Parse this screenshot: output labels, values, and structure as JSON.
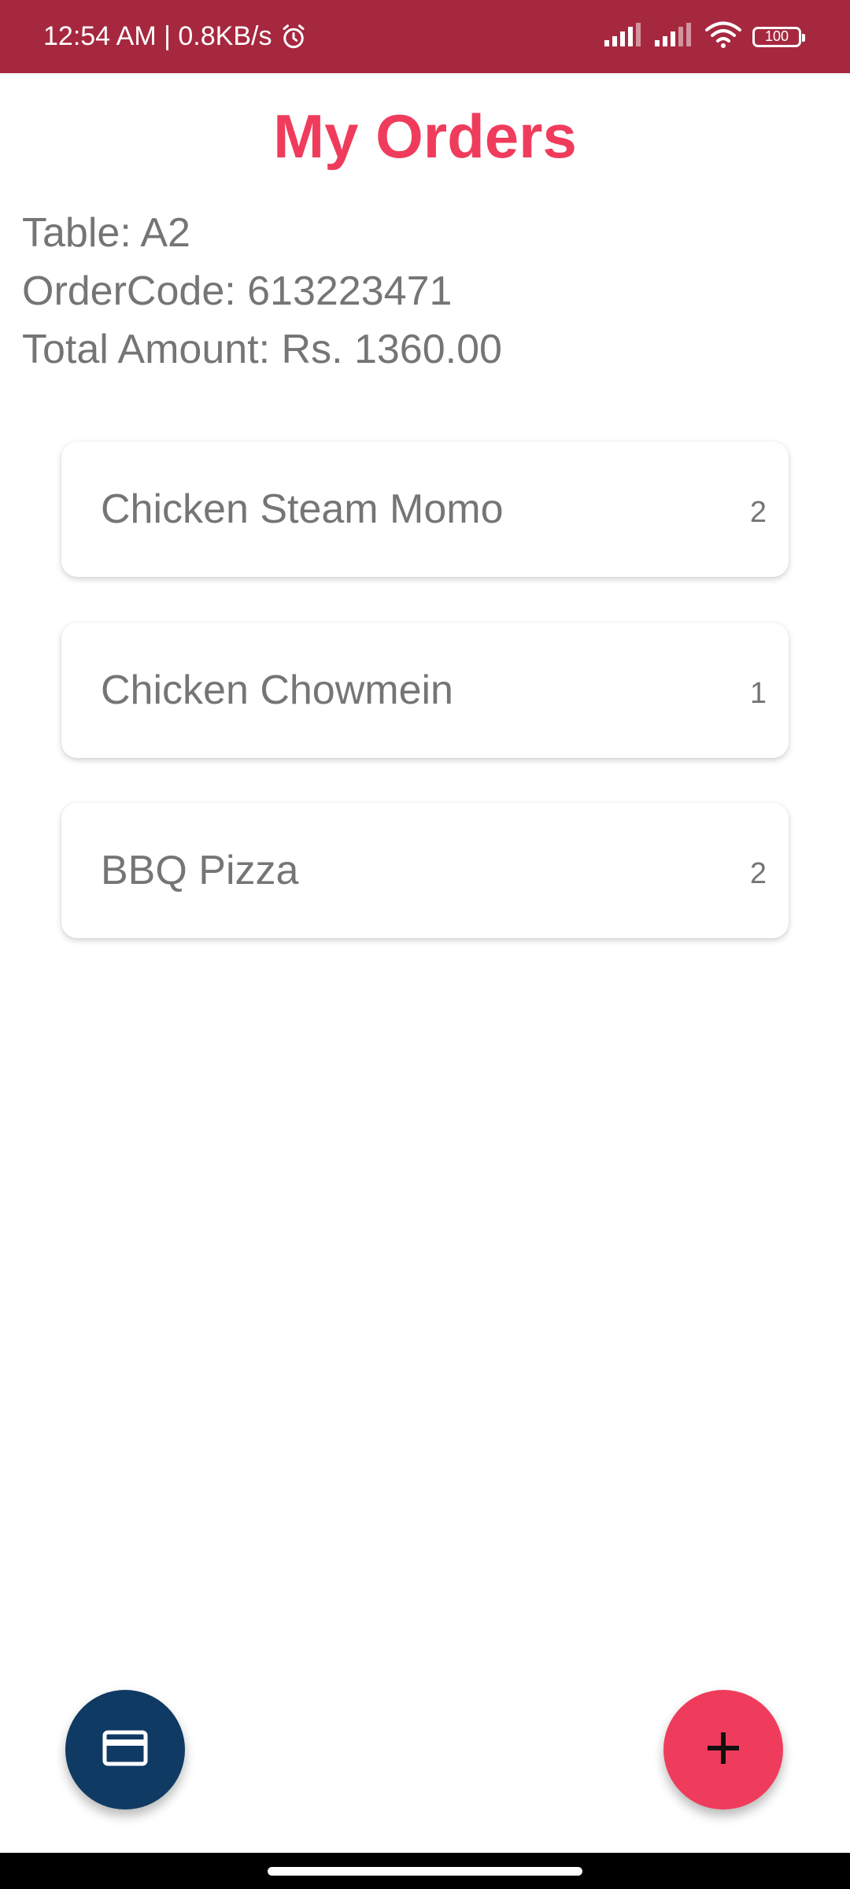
{
  "status_bar": {
    "time_speed": "12:54 AM | 0.8KB/s",
    "battery": "100",
    "background_color": "#a6283f",
    "icons": [
      "alarm-icon",
      "signal-icon",
      "signal-icon",
      "wifi-icon",
      "battery-icon"
    ]
  },
  "header": {
    "title": "My Orders",
    "accent_color": "#f03c5c"
  },
  "order_info": {
    "table": "Table: A2",
    "order_code": "OrderCode: 613223471",
    "total_amount": "Total Amount: Rs. 1360.00"
  },
  "orders": [
    {
      "name": "Chicken Steam Momo",
      "quantity": "2"
    },
    {
      "name": "Chicken Chowmein",
      "quantity": "1"
    },
    {
      "name": "BBQ Pizza",
      "quantity": "2"
    }
  ],
  "fabs": {
    "payment_icon": "credit-card-icon",
    "payment_color": "#0f3a63",
    "add_icon": "plus-icon",
    "add_color": "#f03c5c"
  }
}
